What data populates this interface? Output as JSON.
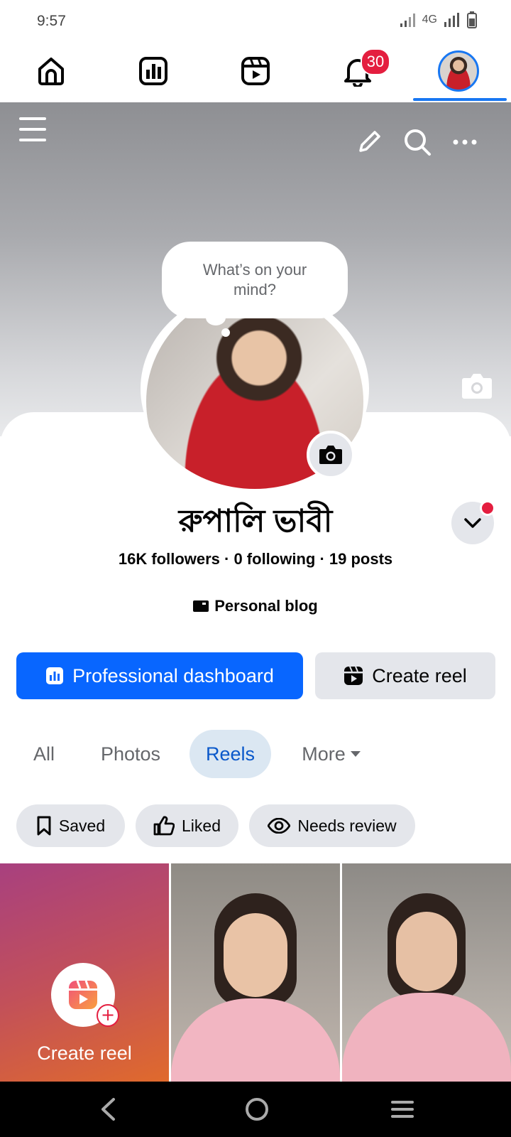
{
  "status_bar": {
    "time": "9:57",
    "network": "4G"
  },
  "nav": {
    "notification_count": "30",
    "tabs": [
      "home",
      "dashboard",
      "reels",
      "notifications",
      "profile"
    ]
  },
  "bubble": {
    "text": "What’s on your mind?"
  },
  "profile": {
    "name": "রুপালি ভাবী",
    "stats": "16K followers · 0 following · 19 posts",
    "category": "Personal blog"
  },
  "buttons": {
    "dashboard": "Professional dashboard",
    "create_reel": "Create reel"
  },
  "tabs": [
    {
      "label": "All"
    },
    {
      "label": "Photos"
    },
    {
      "label": "Reels"
    },
    {
      "label": "More"
    }
  ],
  "chips": [
    {
      "label": "Saved"
    },
    {
      "label": "Liked"
    },
    {
      "label": "Needs review"
    }
  ],
  "grid": {
    "create_label": "Create reel"
  },
  "colors": {
    "accent": "#0866ff",
    "badge": "#e41e3f",
    "selected_tab_bg": "#dbe7f2"
  }
}
